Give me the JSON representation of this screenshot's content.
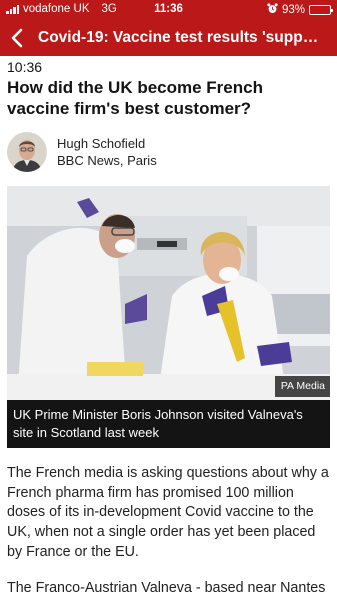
{
  "status_bar": {
    "carrier": "vodafone UK",
    "network": "3G",
    "time": "11:36",
    "battery": "93%",
    "battery_level": 0.93,
    "alarm_icon": "alarm-clock-icon"
  },
  "nav": {
    "back_icon": "chevron-left-icon",
    "title": "Covid-19: Vaccine test results 'suppo..."
  },
  "article": {
    "timestamp": "10:36",
    "headline": "How did the UK become French vaccine firm's best customer?",
    "author": {
      "name": "Hugh Schofield",
      "location": "BBC News, Paris"
    },
    "image": {
      "credit": "PA Media",
      "caption": "UK Prime Minister Boris Johnson visited Valneva's site in Scotland last week"
    },
    "paragraphs": [
      "The French media is asking questions about why a French pharma firm has promised 100 million doses of its in-development Covid vaccine to the UK, when not a single order has yet been placed by France or the EU.",
      "The Franco-Austrian Valneva - based near Nantes"
    ]
  },
  "colors": {
    "brand": "#bb1919",
    "text": "#141414",
    "caption_bg": "#141414"
  }
}
